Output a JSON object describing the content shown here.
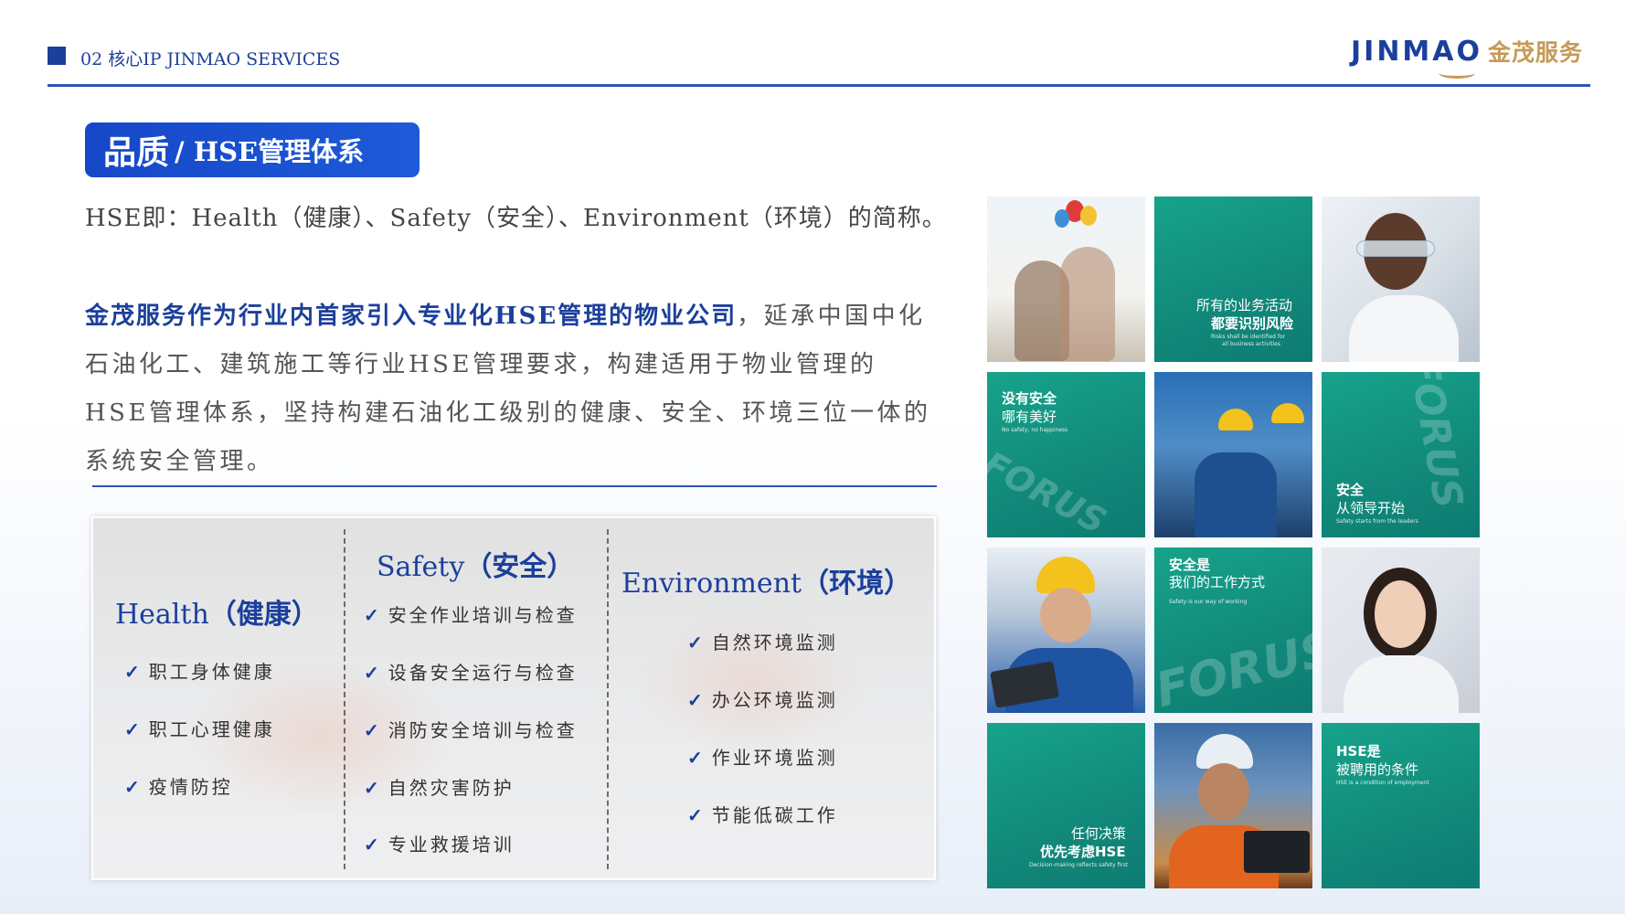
{
  "header": {
    "section": "02 核心IP  JINMAO SERVICES",
    "logo_en": "JINMAO",
    "logo_cn": "金茂服务"
  },
  "title": {
    "cn": "品质",
    "rest": "/ HSE管理体系"
  },
  "intro": "HSE即：Health（健康）、Safety（安全）、Environment（环境）的简称。",
  "paragraph": {
    "highlight": "金茂服务作为行业内首家引入专业化HSE管理的物业公司",
    "body": "，延承中国中化石油化工、建筑施工等行业HSE管理要求，构建适用于物业管理的HSE管理体系，坚持构建石油化工级别的健康、安全、环境三位一体的系统安全管理。"
  },
  "columns": {
    "health": {
      "en": "Health",
      "cn": "（健康）",
      "items": [
        "职工身体健康",
        "职工心理健康",
        "疫情防控"
      ]
    },
    "safety": {
      "en": "Safety",
      "cn": "（安全）",
      "items": [
        "安全作业培训与检查",
        "设备安全运行与检查",
        "消防安全培训与检查",
        "自然灾害防护",
        "专业救援培训"
      ]
    },
    "environment": {
      "en": "Environment",
      "cn": "（环境）",
      "items": [
        "自然环境监测",
        "办公环境监测",
        "作业环境监测",
        "节能低碳工作"
      ]
    },
    "check": "✓"
  },
  "tiles": {
    "t2": {
      "l1": "所有的业务活动",
      "l2": "都要识别风险",
      "sm1": "Risks shall be identified for",
      "sm2": "all business activities"
    },
    "t4": {
      "l1": "没有安全",
      "l2": "哪有美好",
      "sm": "No safety, no happiness"
    },
    "t6": {
      "l1": "安全",
      "l2": "从领导开始",
      "sm": "Safety starts from the leaders"
    },
    "t8": {
      "l1": "安全是",
      "l2": "我们的工作方式",
      "sm": "Safety is our way of working"
    },
    "t10": {
      "l1": "任何决策",
      "l2": "优先考虑HSE",
      "sm": "Decision-making reflects safety first"
    },
    "t12": {
      "l1": "HSE是",
      "l2": "被聘用的条件",
      "sm": "HSE is a condition of employment"
    },
    "forus": "FORUS"
  },
  "colors": {
    "brand_blue": "#1b3f9b",
    "gold": "#c69a57",
    "teal": "#11897a"
  }
}
